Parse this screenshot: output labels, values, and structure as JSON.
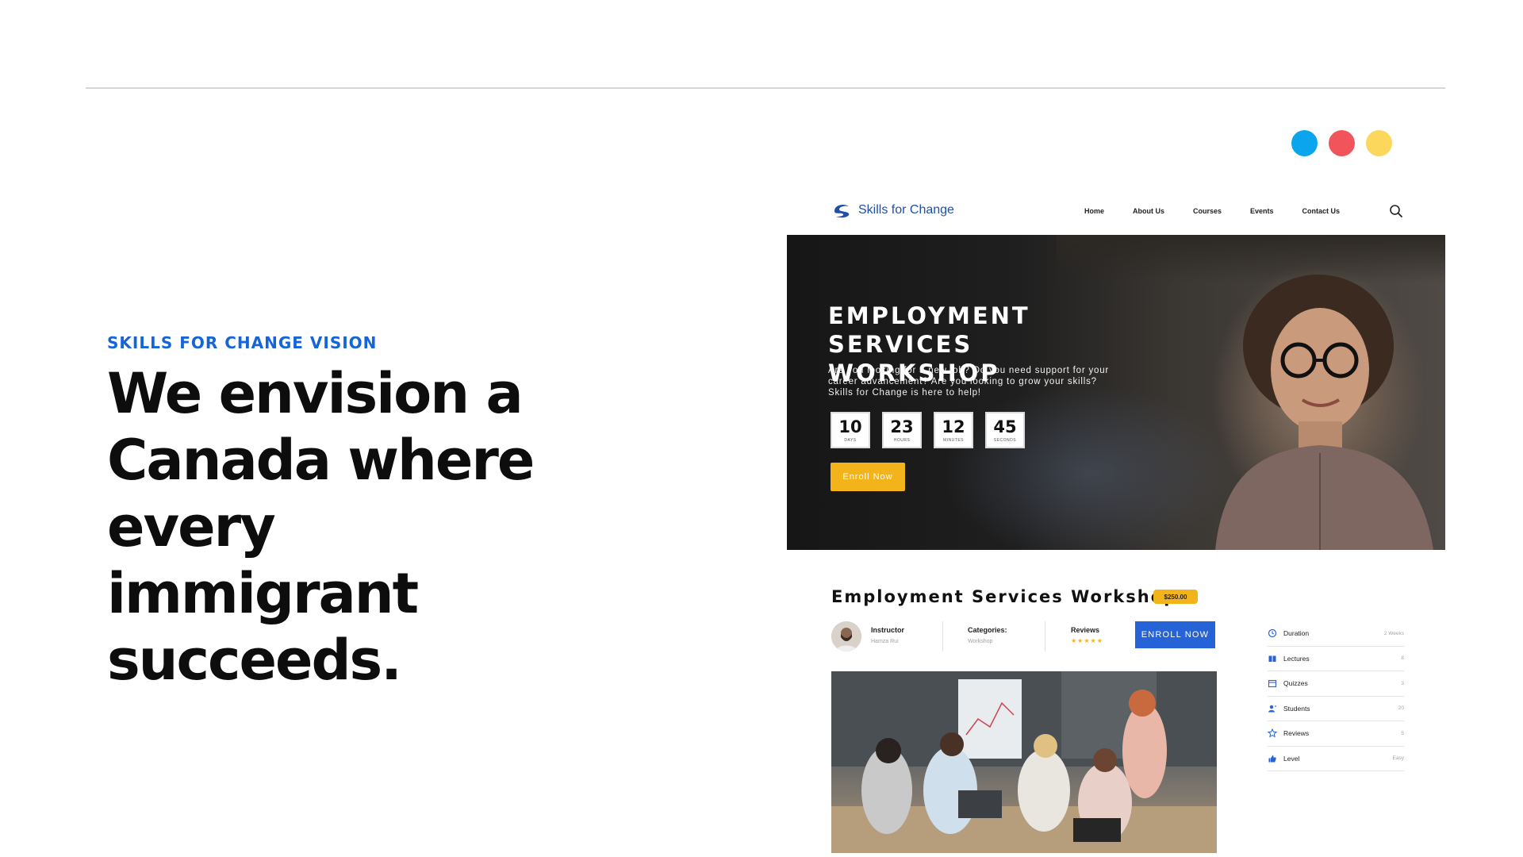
{
  "slide": {
    "eyebrow": "SKILLS FOR CHANGE VISION",
    "headline_lines": [
      "We envision a",
      "Canada where every",
      "immigrant succeeds."
    ],
    "dot_colors": [
      "#0aa5ec",
      "#f2545b",
      "#fbd75b"
    ]
  },
  "site": {
    "logo_text": "Skills for Change",
    "nav": [
      "Home",
      "About Us",
      "Courses",
      "Events",
      "Contact Us"
    ],
    "hero": {
      "title_lines": [
        "EMPLOYMENT SERVICES",
        "WORKSHOP"
      ],
      "description": "Are you looking for a new job? Do you need support for your career advancement? Are you looking to grow your skills? Skills for Change is here to help!",
      "countdown": [
        {
          "value": "10",
          "label": "DAYS"
        },
        {
          "value": "23",
          "label": "HOURS"
        },
        {
          "value": "12",
          "label": "MINUTES"
        },
        {
          "value": "45",
          "label": "SECONDS"
        }
      ],
      "button": "Enroll Now"
    },
    "course": {
      "title": "Employment Services Workshop",
      "price": "$250.00",
      "instructor_label": "Instructor",
      "instructor_name": "Hamza Rui",
      "categories_label": "Categories:",
      "categories_value": "Workshop",
      "reviews_label": "Reviews",
      "stars": "★★★★★",
      "enroll_button": "ENROLL NOW"
    },
    "stats": [
      {
        "icon": "clock-icon",
        "label": "Duration",
        "value": "2 Weeks"
      },
      {
        "icon": "book-icon",
        "label": "Lectures",
        "value": "8"
      },
      {
        "icon": "calendar-icon",
        "label": "Quizzes",
        "value": "3"
      },
      {
        "icon": "students-icon",
        "label": "Students",
        "value": "20"
      },
      {
        "icon": "star-icon",
        "label": "Reviews",
        "value": "5"
      },
      {
        "icon": "thumbs-up-icon",
        "label": "Level",
        "value": "Easy"
      }
    ],
    "accent_blue": "#2563d6",
    "accent_yellow": "#f3b31b"
  }
}
